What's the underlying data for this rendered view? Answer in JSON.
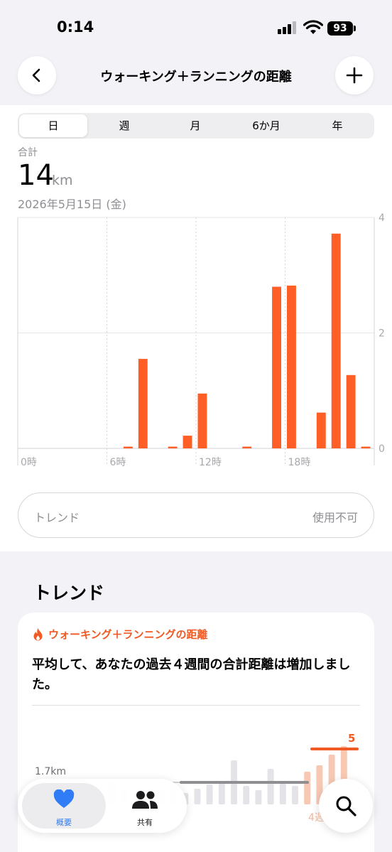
{
  "status_bar": {
    "time": "0:14",
    "battery": "93"
  },
  "nav": {
    "title": "ウォーキング＋ランニングの距離",
    "back_icon": "chevron-left-icon",
    "add_icon": "plus-icon"
  },
  "period_tabs": [
    {
      "label": "日",
      "active": true
    },
    {
      "label": "週",
      "active": false
    },
    {
      "label": "月",
      "active": false
    },
    {
      "label": "6か月",
      "active": false
    },
    {
      "label": "年",
      "active": false
    }
  ],
  "summary": {
    "label": "合計",
    "value": "14",
    "unit": "km",
    "date": "2026年5月15日 (金)"
  },
  "chart_data": {
    "type": "bar",
    "x_tick_labels": [
      "0時",
      "6時",
      "12時",
      "18時"
    ],
    "y_tick_labels": [
      "4",
      "2",
      "0"
    ],
    "ylim": [
      0,
      4
    ],
    "hours": [
      0,
      1,
      2,
      3,
      4,
      5,
      6,
      7,
      8,
      9,
      10,
      11,
      12,
      13,
      14,
      15,
      16,
      17,
      18,
      19,
      20,
      21,
      22,
      23
    ],
    "values": [
      0,
      0,
      0,
      0,
      0,
      0,
      0,
      0.03,
      1.55,
      0,
      0.03,
      0.22,
      0.95,
      0,
      0,
      0.03,
      0,
      2.8,
      2.82,
      0,
      0.62,
      3.72,
      1.27,
      0.03
    ],
    "bar_color": "#ff5f26",
    "grid": true
  },
  "trend_pill": {
    "label": "トレンド",
    "status": "使用不可"
  },
  "trends_section": {
    "title": "トレンド",
    "card": {
      "icon": "flame-icon",
      "metric": "ウォーキング＋ランニングの距離",
      "body": "平均して、あなたの過去４週間の合計距離は増加しました。",
      "avg_label": "1.7km",
      "current_value": "5",
      "weeks_label": "4週",
      "accent_color": "#f05a24"
    }
  },
  "tab_bar": {
    "items": [
      {
        "label": "概要",
        "icon": "heart-icon",
        "active": true
      },
      {
        "label": "共有",
        "icon": "people-icon",
        "active": false
      }
    ],
    "search_icon": "magnifier-icon"
  }
}
